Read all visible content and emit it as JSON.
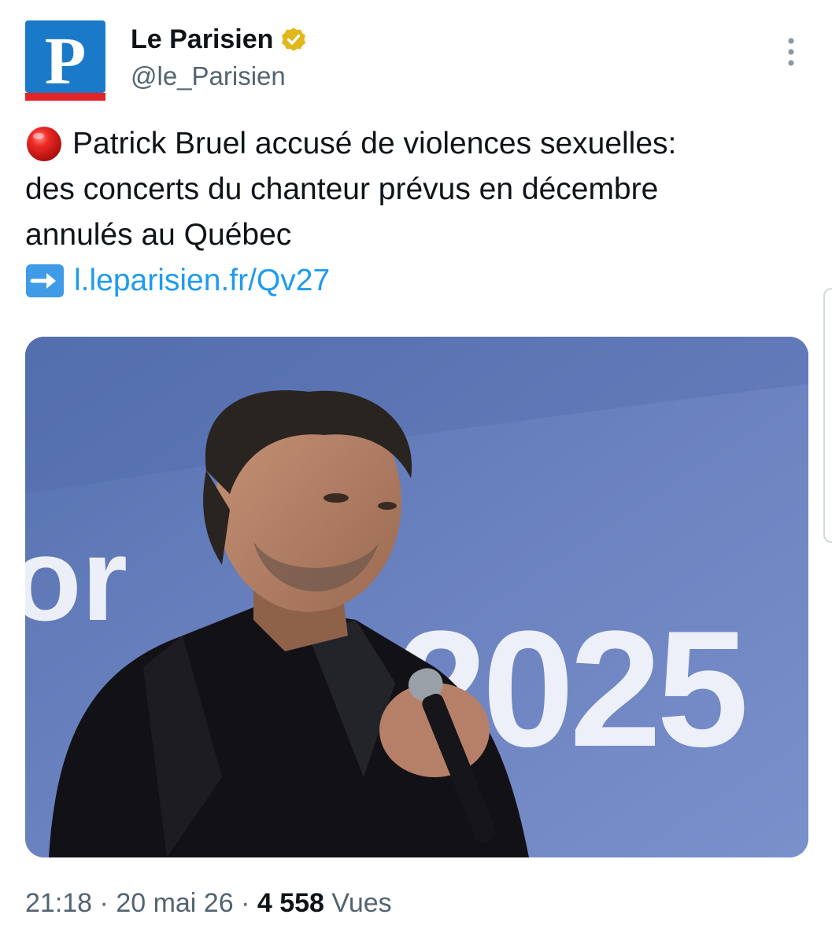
{
  "author": {
    "display_name": "Le Parisien",
    "handle": "@le_Parisien",
    "avatar_letter": "P",
    "verified": true
  },
  "tweet": {
    "line1": "Patrick Bruel accusé de violences sexuelles:",
    "line2": "des concerts du chanteur prévus en décembre",
    "line3": "annulés au Québec",
    "link_text": "l.leparisien.fr/Qv27",
    "lead_icon": "red-circle-icon",
    "link_icon": "right-arrow-icon"
  },
  "media": {
    "background_text": "2025"
  },
  "meta": {
    "time": "21:18",
    "sep1": " · ",
    "date": "20 mai 26",
    "sep2": " · ",
    "views_count": "4 558",
    "views_label": " Vues"
  },
  "colors": {
    "brand_blue": "#1a7ac9",
    "brand_red": "#e2242a",
    "link": "#1d9bf0",
    "verified_gold": "#e2b719",
    "muted_text": "#536471"
  }
}
